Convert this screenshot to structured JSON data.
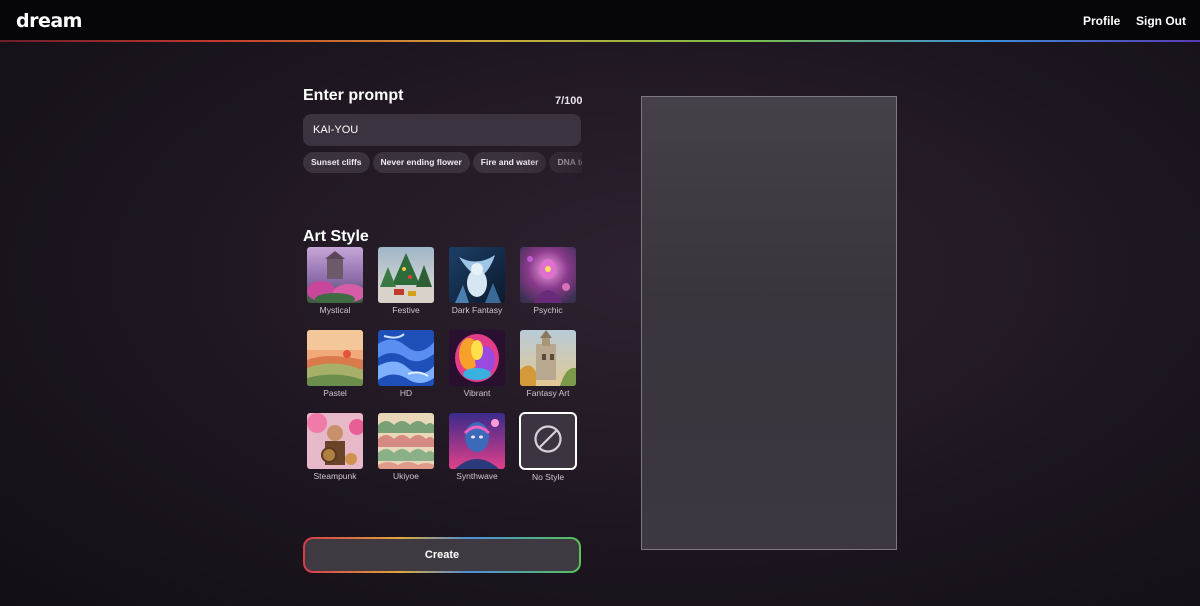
{
  "header": {
    "logo": "dream",
    "nav": {
      "profile": "Profile",
      "sign_out": "Sign Out"
    }
  },
  "prompt": {
    "title": "Enter prompt",
    "char_count": "7/100",
    "value": "KAI-YOU",
    "suggestions": [
      "Sunset cliffs",
      "Never ending flower",
      "Fire and water",
      "DNA tornado"
    ]
  },
  "art_style": {
    "title": "Art Style",
    "styles": [
      {
        "label": "Mystical"
      },
      {
        "label": "Festive"
      },
      {
        "label": "Dark Fantasy"
      },
      {
        "label": "Psychic"
      },
      {
        "label": "Pastel"
      },
      {
        "label": "HD"
      },
      {
        "label": "Vibrant"
      },
      {
        "label": "Fantasy Art"
      },
      {
        "label": "Steampunk"
      },
      {
        "label": "Ukiyoe"
      },
      {
        "label": "Synthwave"
      },
      {
        "label": "No Style"
      }
    ],
    "selected": "No Style"
  },
  "create_button": {
    "label": "Create"
  },
  "icons": {
    "no_style": "prohibited-icon"
  },
  "colors": {
    "background": "#1d1620",
    "topbar": "#060508",
    "input_bg": "#3c3340",
    "chip_bg": "#3a323c",
    "canvas_bg": "#423c45"
  }
}
